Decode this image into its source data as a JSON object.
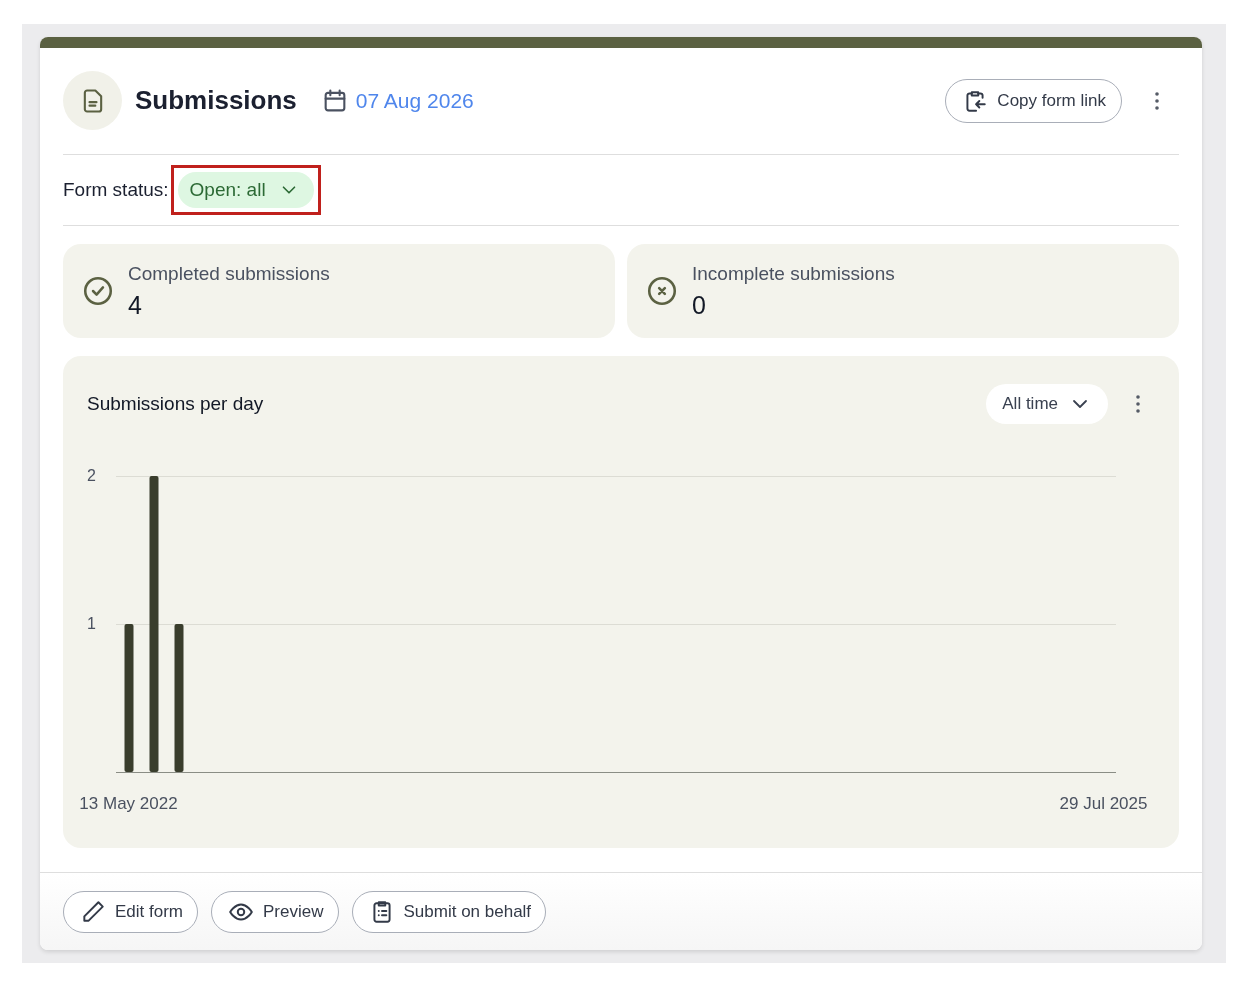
{
  "header": {
    "title": "Submissions",
    "date": "07 Aug 2026",
    "copy_button": "Copy form link"
  },
  "form_status": {
    "label": "Form status:",
    "value": "Open: all",
    "highlighted": true
  },
  "stats": [
    {
      "kind": "completed",
      "label": "Completed submissions",
      "count": "4"
    },
    {
      "kind": "incomplete",
      "label": "Incomplete submissions",
      "count": "0"
    }
  ],
  "chart_panel": {
    "title": "Submissions per day",
    "range": "All time",
    "chart_data": {
      "type": "bar",
      "categories": [
        "13 May 2022",
        null,
        null,
        null,
        null,
        null,
        null,
        null,
        null,
        null,
        null,
        null,
        null,
        null,
        null,
        null,
        null,
        null,
        null,
        null,
        null,
        null,
        null,
        null,
        null,
        null,
        null,
        null,
        null,
        null,
        null,
        null,
        null,
        null,
        null,
        null,
        null,
        null,
        null,
        "29 Jul 2025"
      ],
      "values": [
        1,
        2,
        1,
        null,
        null,
        null,
        null,
        null,
        null,
        null,
        null,
        null,
        null,
        null,
        null,
        null,
        null,
        null,
        null,
        null,
        null,
        null,
        null,
        null,
        null,
        null,
        null,
        null,
        null,
        null,
        null,
        null,
        null,
        null,
        null,
        null,
        null,
        null,
        null,
        null
      ],
      "ylim": [
        0,
        2
      ],
      "yticks": [
        1,
        2
      ]
    }
  },
  "footer_buttons": [
    {
      "kind": "edit",
      "label": "Edit form"
    },
    {
      "kind": "preview",
      "label": "Preview"
    },
    {
      "kind": "submit",
      "label": "Submit on behalf"
    }
  ]
}
